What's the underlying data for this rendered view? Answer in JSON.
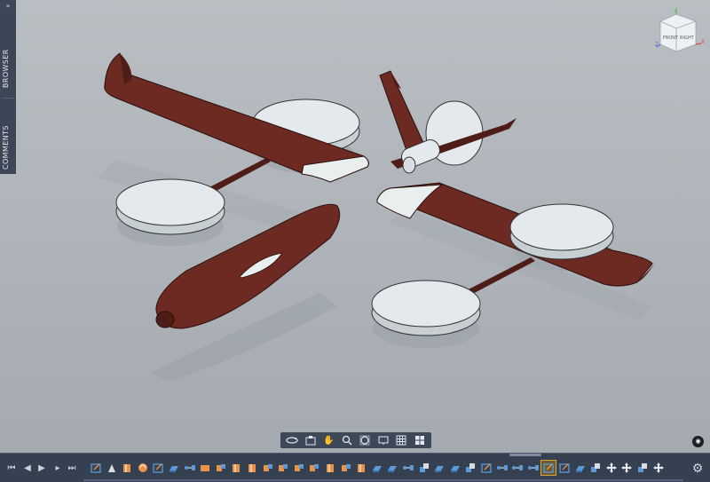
{
  "browser_panel": {
    "expand_label": "»",
    "browser_tab": "BROWSER",
    "comments_tab": "COMMENTS"
  },
  "viewcube": {
    "face_front": "FRONT",
    "face_right": "RIGHT",
    "axis_x": "X",
    "axis_y": "Y",
    "axis_z": "Z"
  },
  "navigation_bar": {
    "tools": [
      "orbit-icon",
      "look-at-icon",
      "pan-icon",
      "zoom-icon",
      "fit-icon",
      "display-settings-icon",
      "grid-icon",
      "viewports-icon"
    ]
  },
  "timeline": {
    "controls": [
      "skip-to-start-icon",
      "step-back-icon",
      "play-icon",
      "step-forward-icon",
      "skip-to-end-icon"
    ],
    "features": [
      {
        "icon": "sketch-icon",
        "active": false
      },
      {
        "icon": "component-icon",
        "active": false
      },
      {
        "icon": "extrude-icon",
        "active": false
      },
      {
        "icon": "revolve-icon",
        "active": false
      },
      {
        "icon": "sketch-icon",
        "active": false
      },
      {
        "icon": "body-icon",
        "active": false
      },
      {
        "icon": "joint-icon",
        "active": false
      },
      {
        "icon": "plane-icon",
        "active": false
      },
      {
        "icon": "move-icon",
        "active": false
      },
      {
        "icon": "extrude-icon",
        "active": false
      },
      {
        "icon": "extrude-icon",
        "active": false
      },
      {
        "icon": "move-icon",
        "active": false
      },
      {
        "icon": "move-icon",
        "active": false
      },
      {
        "icon": "move-icon",
        "active": false
      },
      {
        "icon": "move-icon",
        "active": false
      },
      {
        "icon": "extrude-icon",
        "active": false
      },
      {
        "icon": "move-icon",
        "active": false
      },
      {
        "icon": "extrude-icon",
        "active": false
      },
      {
        "icon": "body-icon",
        "active": false
      },
      {
        "icon": "body-icon",
        "active": false
      },
      {
        "icon": "joint-icon",
        "active": false
      },
      {
        "icon": "combine-icon",
        "active": false
      },
      {
        "icon": "body-icon",
        "active": false
      },
      {
        "icon": "body-icon",
        "active": false
      },
      {
        "icon": "combine-icon",
        "active": false
      },
      {
        "icon": "sketch-icon",
        "active": false
      },
      {
        "icon": "joint-icon",
        "active": false
      },
      {
        "icon": "joint-icon",
        "active": false
      },
      {
        "icon": "joint-icon",
        "active": false
      },
      {
        "icon": "sketch-icon",
        "active": true
      },
      {
        "icon": "sketch-icon",
        "active": false
      },
      {
        "icon": "body-icon",
        "active": false
      },
      {
        "icon": "combine-icon",
        "active": false
      },
      {
        "icon": "move-arrows-icon",
        "active": false
      },
      {
        "icon": "move-arrows-icon",
        "active": false
      },
      {
        "icon": "combine-icon",
        "active": false
      },
      {
        "icon": "move-arrows-icon",
        "active": false
      }
    ],
    "settings_icon": "gear-icon"
  },
  "colors": {
    "wing": "#6d2a22",
    "wing_dark": "#4f1d18",
    "wing_tip": "#e9eeee",
    "disc": "#e3e9ec",
    "background_top": "#b9bec3",
    "background_bottom": "#a4aab0",
    "toolbar": "#354051",
    "accent_orange": "#e8924a",
    "accent_blue": "#5b9ad6"
  }
}
